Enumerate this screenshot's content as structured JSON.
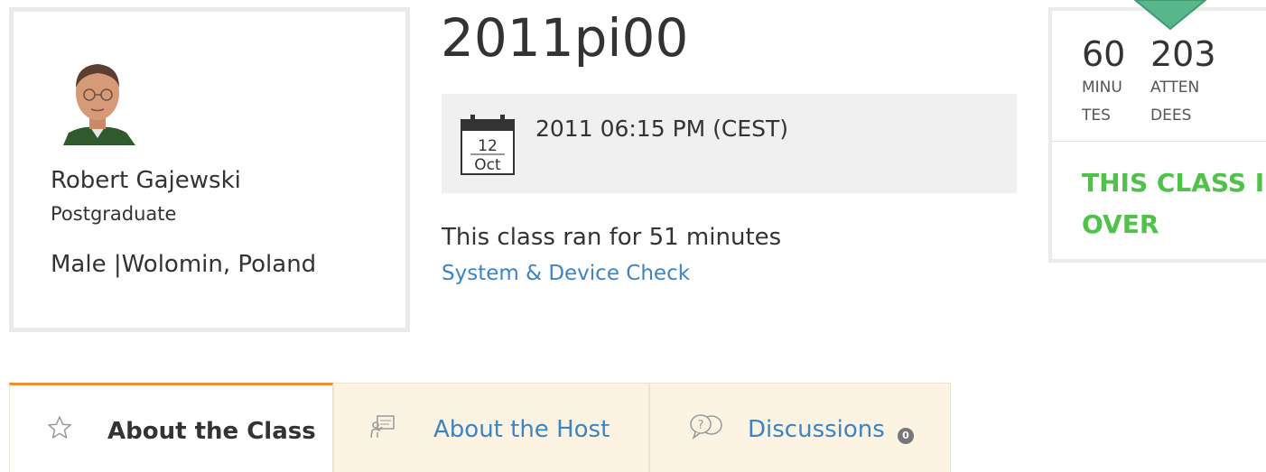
{
  "host": {
    "name": "Robert Gajewski",
    "role": "Postgraduate",
    "details": "Male |Wolomin, Poland"
  },
  "class_info": {
    "title": "2011pi00",
    "calendar_day": "12",
    "calendar_month": "Oct",
    "date_time": "2011 06:15 PM (CEST)",
    "duration": "This class ran for 51 minutes",
    "device_check_link": "System & Device Check"
  },
  "stats": {
    "minutes_value": "60",
    "minutes_label": "MINU\nTES",
    "attendees_value": "203",
    "attendees_label": "ATTEN\nDEES",
    "status": "THIS CLASS IS\nOVER"
  },
  "tabs": [
    {
      "label": "About the Class",
      "icon": "star-icon",
      "active": true
    },
    {
      "label": "About the Host",
      "icon": "presentation-icon",
      "active": false
    },
    {
      "label": "Discussions",
      "icon": "question-bubbles-icon",
      "active": false,
      "badge": "0"
    }
  ],
  "colors": {
    "link": "#3b84c5",
    "status_green": "#4fc24a",
    "active_tab_accent": "#f5892e",
    "tab_background": "#fdf3e3",
    "marker_green": "#58b68c"
  }
}
